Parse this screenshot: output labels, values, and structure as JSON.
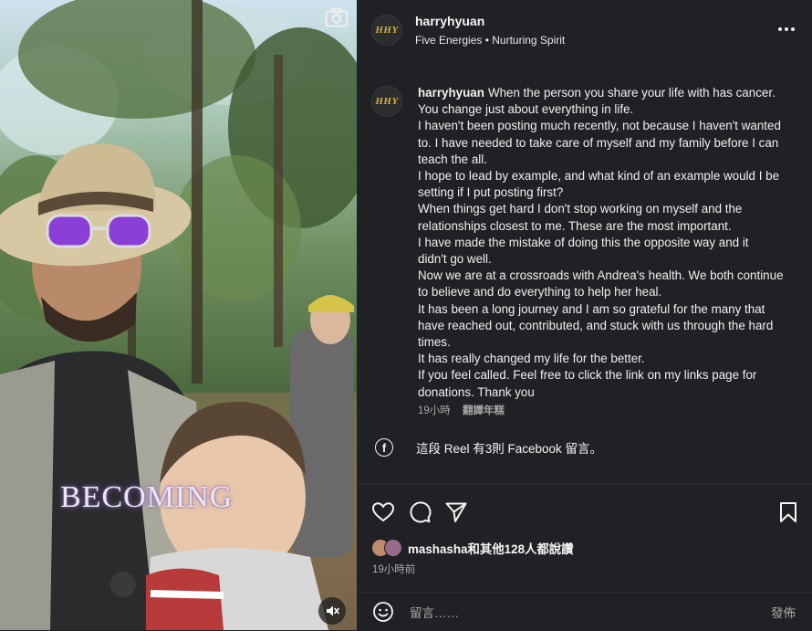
{
  "media": {
    "overlay_text": "BECOMING",
    "camera_icon": "camera-icon",
    "mute_icon": "speaker-muted-icon"
  },
  "header": {
    "avatar_text": "HHY",
    "username": "harryhyuan",
    "subtitle": "Five Energies • Nurturing Spirit",
    "more_icon": "more-options-icon"
  },
  "caption": {
    "avatar_text": "HHY",
    "username": "harryhyuan",
    "lines": [
      "When the person you share your life with has cancer.",
      "You change just about everything in life.",
      "I haven't been posting much recently, not because I haven't wanted",
      "to. I have needed to take care of myself and my family before I can",
      "teach the all.",
      "I hope to lead by example, and what kind of an example would I be",
      "setting if I put posting first?",
      "When things get hard I don't stop working on myself and the",
      "relationships closest to me. These are the most important.",
      "I have made the mistake of doing this the opposite way and it",
      "didn't go well.",
      "Now we are at a crossroads with Andrea's health. We both continue",
      "to believe and do everything to help her heal.",
      "It has been a long journey and I am so grateful for the many that",
      "have reached out, contributed, and stuck with us through the hard",
      "times.",
      "It has really changed my life for the better.",
      "If you feel called. Feel free to click the link on my links page for",
      "donations. Thank you"
    ],
    "time": "19小時",
    "translate": "翻譯年糕"
  },
  "facebook": {
    "icon": "facebook-icon",
    "text": "這段 Reel 有3則 Facebook 留言。"
  },
  "actions": {
    "like_icon": "heart-icon",
    "comment_icon": "comment-bubble-icon",
    "share_icon": "paper-plane-icon",
    "save_icon": "bookmark-icon"
  },
  "likes": {
    "text": "mashasha和其他128人都說讚",
    "time": "19小時前"
  },
  "comment": {
    "emoji_icon": "emoji-icon",
    "placeholder": "留言……",
    "post_label": "發佈"
  },
  "colors": {
    "panel_bg": "#1f2124",
    "text_primary": "#f5f5f5",
    "text_secondary": "#a8a8a8",
    "avatar_accent": "#d4b23a"
  }
}
